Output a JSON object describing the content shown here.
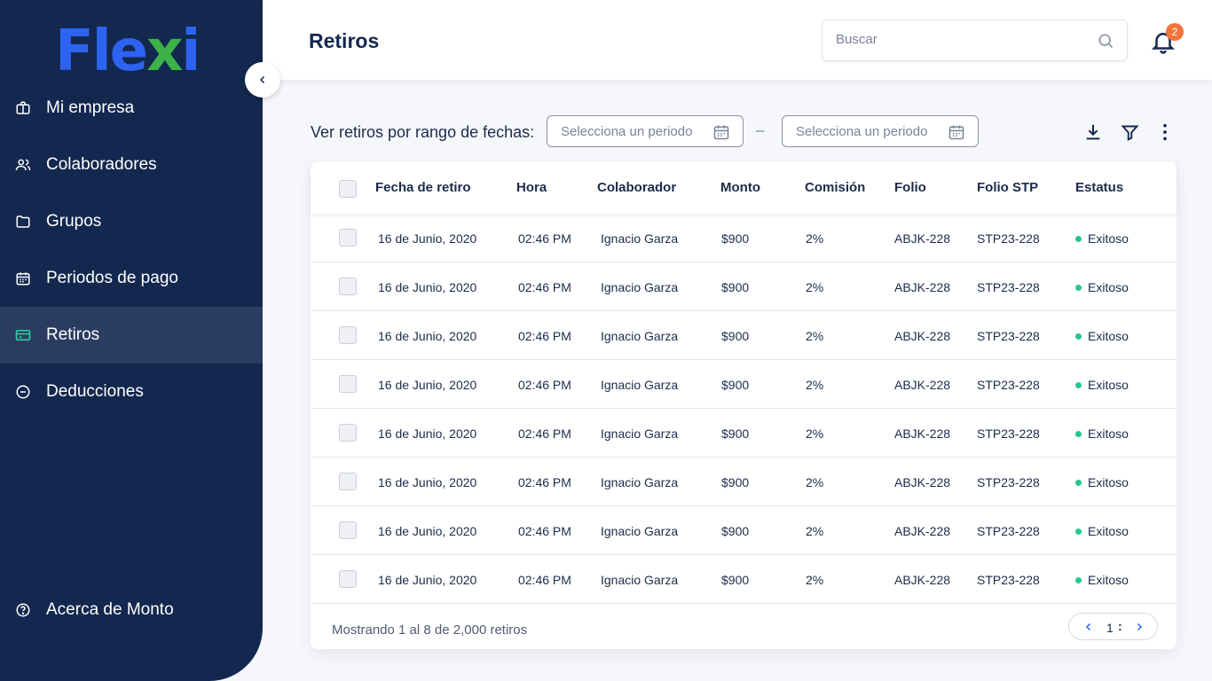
{
  "app": {
    "logo_main": "Fle",
    "logo_x": "x",
    "logo_end": "i"
  },
  "sidebar": {
    "items": [
      {
        "label": "Mi empresa",
        "icon": "briefcase-icon",
        "active": false
      },
      {
        "label": "Colaboradores",
        "icon": "users-icon",
        "active": false
      },
      {
        "label": "Grupos",
        "icon": "folder-icon",
        "active": false
      },
      {
        "label": "Periodos de pago",
        "icon": "calendar-icon",
        "active": false
      },
      {
        "label": "Retiros",
        "icon": "card-icon",
        "active": true
      },
      {
        "label": "Deducciones",
        "icon": "minus-circle-icon",
        "active": false
      }
    ],
    "bottom_item": {
      "label": "Acerca de Monto",
      "icon": "help-circle-icon"
    },
    "collapse_icon": "chevron-left-icon"
  },
  "header": {
    "title": "Retiros",
    "search_placeholder": "Buscar",
    "notification_count": "2"
  },
  "filters": {
    "label": "Ver retiros por rango de fechas:",
    "start_placeholder": "Selecciona un periodo",
    "end_placeholder": "Selecciona un periodo",
    "separator": "–",
    "tools": [
      "download-icon",
      "filter-icon",
      "more-vertical-icon"
    ]
  },
  "table": {
    "columns": [
      "Fecha de retiro",
      "Hora",
      "Colaborador",
      "Monto",
      "Comisión",
      "Folio",
      "Folio STP",
      "Estatus"
    ],
    "rows": [
      [
        "16 de Junio, 2020",
        "02:46 PM",
        "Ignacio Garza",
        "$900",
        "2%",
        "ABJK-228",
        "STP23-228",
        "Exitoso"
      ],
      [
        "16 de Junio, 2020",
        "02:46 PM",
        "Ignacio Garza",
        "$900",
        "2%",
        "ABJK-228",
        "STP23-228",
        "Exitoso"
      ],
      [
        "16 de Junio, 2020",
        "02:46 PM",
        "Ignacio Garza",
        "$900",
        "2%",
        "ABJK-228",
        "STP23-228",
        "Exitoso"
      ],
      [
        "16 de Junio, 2020",
        "02:46 PM",
        "Ignacio Garza",
        "$900",
        "2%",
        "ABJK-228",
        "STP23-228",
        "Exitoso"
      ],
      [
        "16 de Junio, 2020",
        "02:46 PM",
        "Ignacio Garza",
        "$900",
        "2%",
        "ABJK-228",
        "STP23-228",
        "Exitoso"
      ],
      [
        "16 de Junio, 2020",
        "02:46 PM",
        "Ignacio Garza",
        "$900",
        "2%",
        "ABJK-228",
        "STP23-228",
        "Exitoso"
      ],
      [
        "16 de Junio, 2020",
        "02:46 PM",
        "Ignacio Garza",
        "$900",
        "2%",
        "ABJK-228",
        "STP23-228",
        "Exitoso"
      ],
      [
        "16 de Junio, 2020",
        "02:46 PM",
        "Ignacio Garza",
        "$900",
        "2%",
        "ABJK-228",
        "STP23-228",
        "Exitoso"
      ]
    ],
    "status_color": "#22c98f",
    "footer_text": "Mostrando 1 al 8 de 2,000 retiros",
    "page": "1",
    "page_separator": ":"
  },
  "colors": {
    "sidebar_bg": "#13284f",
    "sidebar_active": "#2a3d61",
    "accent_blue": "#2d63f0",
    "accent_green": "#3db24a",
    "badge": "#f4733b"
  }
}
